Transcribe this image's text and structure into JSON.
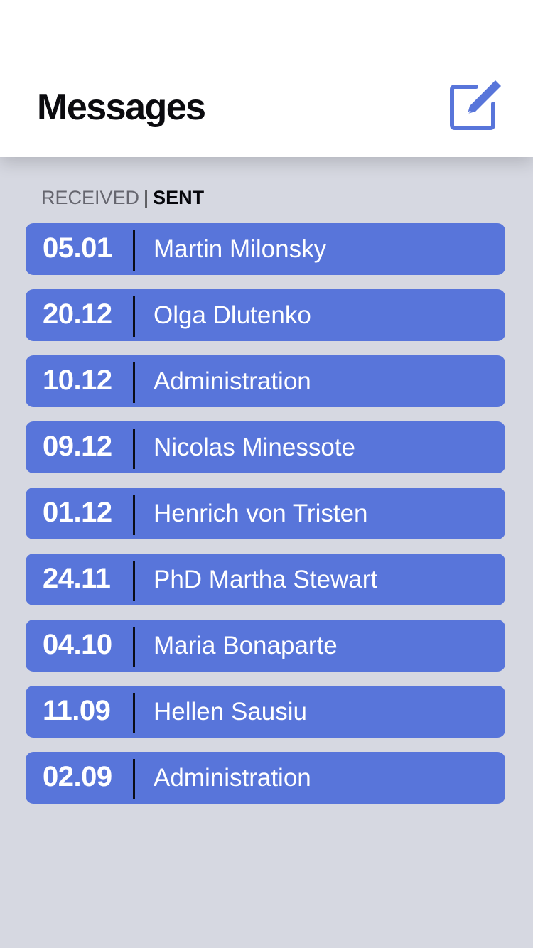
{
  "header": {
    "title": "Messages",
    "compose_icon": "compose-edit-icon",
    "accent_color": "#5875da"
  },
  "tabs": {
    "received_label": "RECEIVED",
    "divider": "|",
    "sent_label": "SENT",
    "active": "SENT"
  },
  "messages": [
    {
      "date": "05.01",
      "name": "Martin Milonsky"
    },
    {
      "date": "20.12",
      "name": "Olga Dlutenko"
    },
    {
      "date": "10.12",
      "name": "Administration"
    },
    {
      "date": "09.12",
      "name": "Nicolas Minessote"
    },
    {
      "date": "01.12",
      "name": "Henrich von Tristen"
    },
    {
      "date": "24.11",
      "name": "PhD Martha Stewart"
    },
    {
      "date": "04.10",
      "name": "Maria Bonaparte"
    },
    {
      "date": "11.09",
      "name": "Hellen Sausiu"
    },
    {
      "date": "02.09",
      "name": "Administration"
    }
  ],
  "colors": {
    "background": "#d6d8e1",
    "row_background": "#5875da",
    "row_text": "#ffffff",
    "divider": "#0b0d18"
  }
}
